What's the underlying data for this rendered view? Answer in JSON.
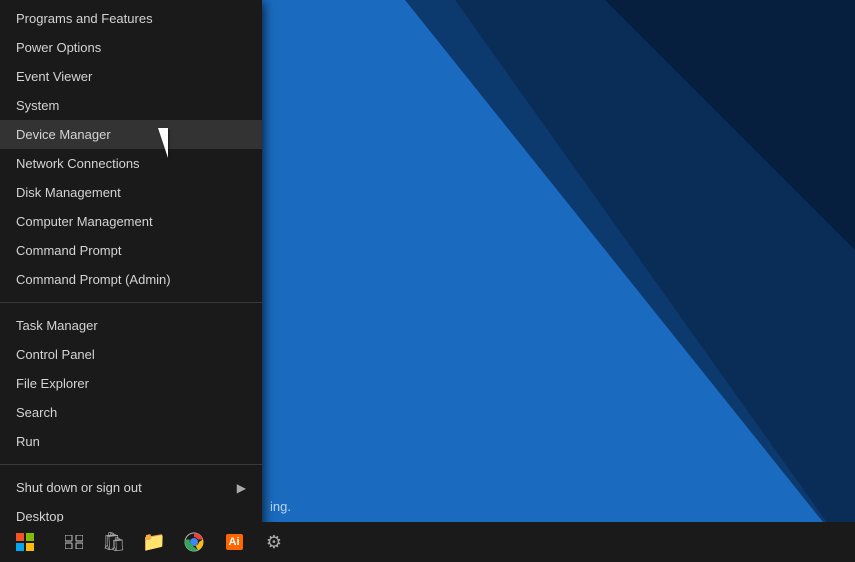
{
  "menu": {
    "items_top": [
      {
        "label": "Programs and Features",
        "id": "programs-features"
      },
      {
        "label": "Power Options",
        "id": "power-options"
      },
      {
        "label": "Event Viewer",
        "id": "event-viewer"
      },
      {
        "label": "System",
        "id": "system"
      },
      {
        "label": "Device Manager",
        "id": "device-manager",
        "active": true
      },
      {
        "label": "Network Connections",
        "id": "network-connections"
      },
      {
        "label": "Disk Management",
        "id": "disk-management"
      },
      {
        "label": "Computer Management",
        "id": "computer-management"
      },
      {
        "label": "Command Prompt",
        "id": "command-prompt"
      },
      {
        "label": "Command Prompt (Admin)",
        "id": "command-prompt-admin"
      }
    ],
    "items_bottom": [
      {
        "label": "Task Manager",
        "id": "task-manager"
      },
      {
        "label": "Control Panel",
        "id": "control-panel"
      },
      {
        "label": "File Explorer",
        "id": "file-explorer"
      },
      {
        "label": "Search",
        "id": "search"
      },
      {
        "label": "Run",
        "id": "run"
      }
    ],
    "shutdown": {
      "label": "Shut down or sign out",
      "id": "shutdown"
    },
    "desktop": {
      "label": "Desktop",
      "id": "desktop-item"
    }
  },
  "taskbar": {
    "search_placeholder": "ing.",
    "icons": [
      {
        "name": "task-view-icon",
        "symbol": "⧉"
      },
      {
        "name": "store-icon",
        "symbol": "🛍"
      },
      {
        "name": "folder-icon",
        "symbol": "📁"
      },
      {
        "name": "chrome-icon",
        "symbol": "⬤"
      },
      {
        "name": "illustrator-icon",
        "symbol": "Ai"
      },
      {
        "name": "settings-icon",
        "symbol": "⚙"
      }
    ]
  }
}
